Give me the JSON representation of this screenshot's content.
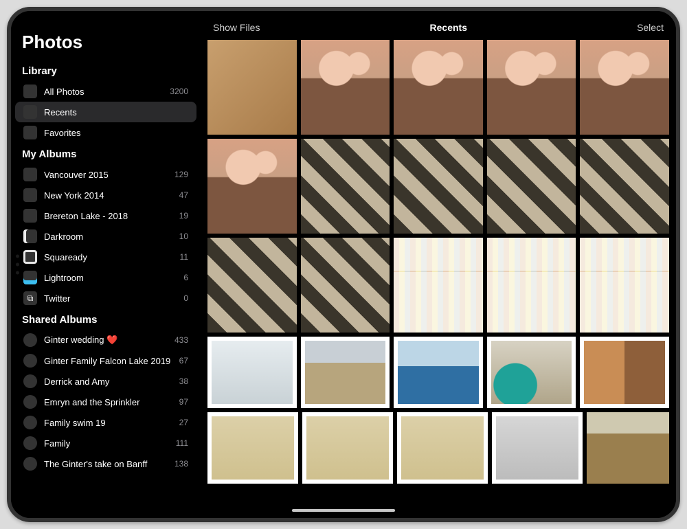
{
  "appTitle": "Photos",
  "sections": {
    "library": {
      "header": "Library",
      "items": [
        {
          "label": "All Photos",
          "count": "3200",
          "icon": "ic-grid",
          "selected": false
        },
        {
          "label": "Recents",
          "count": "",
          "icon": "ic-grid",
          "selected": true
        },
        {
          "label": "Favorites",
          "count": "",
          "icon": "ic-people",
          "selected": false
        }
      ]
    },
    "myAlbums": {
      "header": "My Albums",
      "items": [
        {
          "label": "Vancouver 2015",
          "count": "129",
          "icon": "ic-city"
        },
        {
          "label": "New York 2014",
          "count": "47",
          "icon": "ic-ny"
        },
        {
          "label": "Brereton Lake - 2018",
          "count": "19",
          "icon": "ic-lake"
        },
        {
          "label": "Darkroom",
          "count": "10",
          "icon": "ic-dark"
        },
        {
          "label": "Squaready",
          "count": "11",
          "icon": "ic-sq"
        },
        {
          "label": "Lightroom",
          "count": "6",
          "icon": "ic-lr"
        },
        {
          "label": "Twitter",
          "count": "0",
          "icon": "ic-tw",
          "glyph": "⧉"
        }
      ]
    },
    "sharedAlbums": {
      "header": "Shared Albums",
      "items": [
        {
          "label": "Ginter wedding ❤️",
          "count": "433",
          "icon": "ic-heart",
          "round": true
        },
        {
          "label": "Ginter Family Falcon Lake 2019",
          "count": "67",
          "icon": "ic-trail",
          "round": true
        },
        {
          "label": "Derrick and Amy",
          "count": "38",
          "icon": "ic-pair",
          "round": true
        },
        {
          "label": "Emryn and the Sprinkler",
          "count": "97",
          "icon": "ic-spray",
          "round": true
        },
        {
          "label": "Family swim 19",
          "count": "27",
          "icon": "ic-swim",
          "round": true
        },
        {
          "label": "Family",
          "count": "111",
          "icon": "ic-fam",
          "round": true
        },
        {
          "label": "The Ginter's take on Banff",
          "count": "138",
          "icon": "ic-banff",
          "round": true
        }
      ]
    }
  },
  "topbar": {
    "left": "Show Files",
    "title": "Recents",
    "right": "Select"
  },
  "gridRows": [
    {
      "height": "tall",
      "cells": [
        {
          "c": "wood"
        },
        {
          "c": "selfie"
        },
        {
          "c": "selfie"
        },
        {
          "c": "selfie"
        },
        {
          "c": "selfie"
        }
      ]
    },
    {
      "height": "tall",
      "cells": [
        {
          "c": "selfie"
        },
        {
          "c": "store"
        },
        {
          "c": "store"
        },
        {
          "c": "store"
        },
        {
          "c": "store"
        }
      ]
    },
    {
      "height": "tall",
      "cells": [
        {
          "c": "store"
        },
        {
          "c": "store"
        },
        {
          "c": "aisle"
        },
        {
          "c": "aisle"
        },
        {
          "c": "aisle"
        }
      ]
    },
    {
      "height": "square",
      "cells": [
        {
          "c": "snow",
          "b": true
        },
        {
          "c": "paris",
          "b": true
        },
        {
          "c": "sea",
          "b": true
        },
        {
          "c": "lagoon",
          "b": true
        },
        {
          "c": "town",
          "b": true
        }
      ]
    },
    {
      "height": "square",
      "cells": [
        {
          "c": "beach",
          "b": true
        },
        {
          "c": "beach",
          "b": true
        },
        {
          "c": "beach",
          "b": true
        },
        {
          "c": "bike",
          "b": true
        },
        {
          "c": "village",
          "b": false
        }
      ]
    }
  ]
}
